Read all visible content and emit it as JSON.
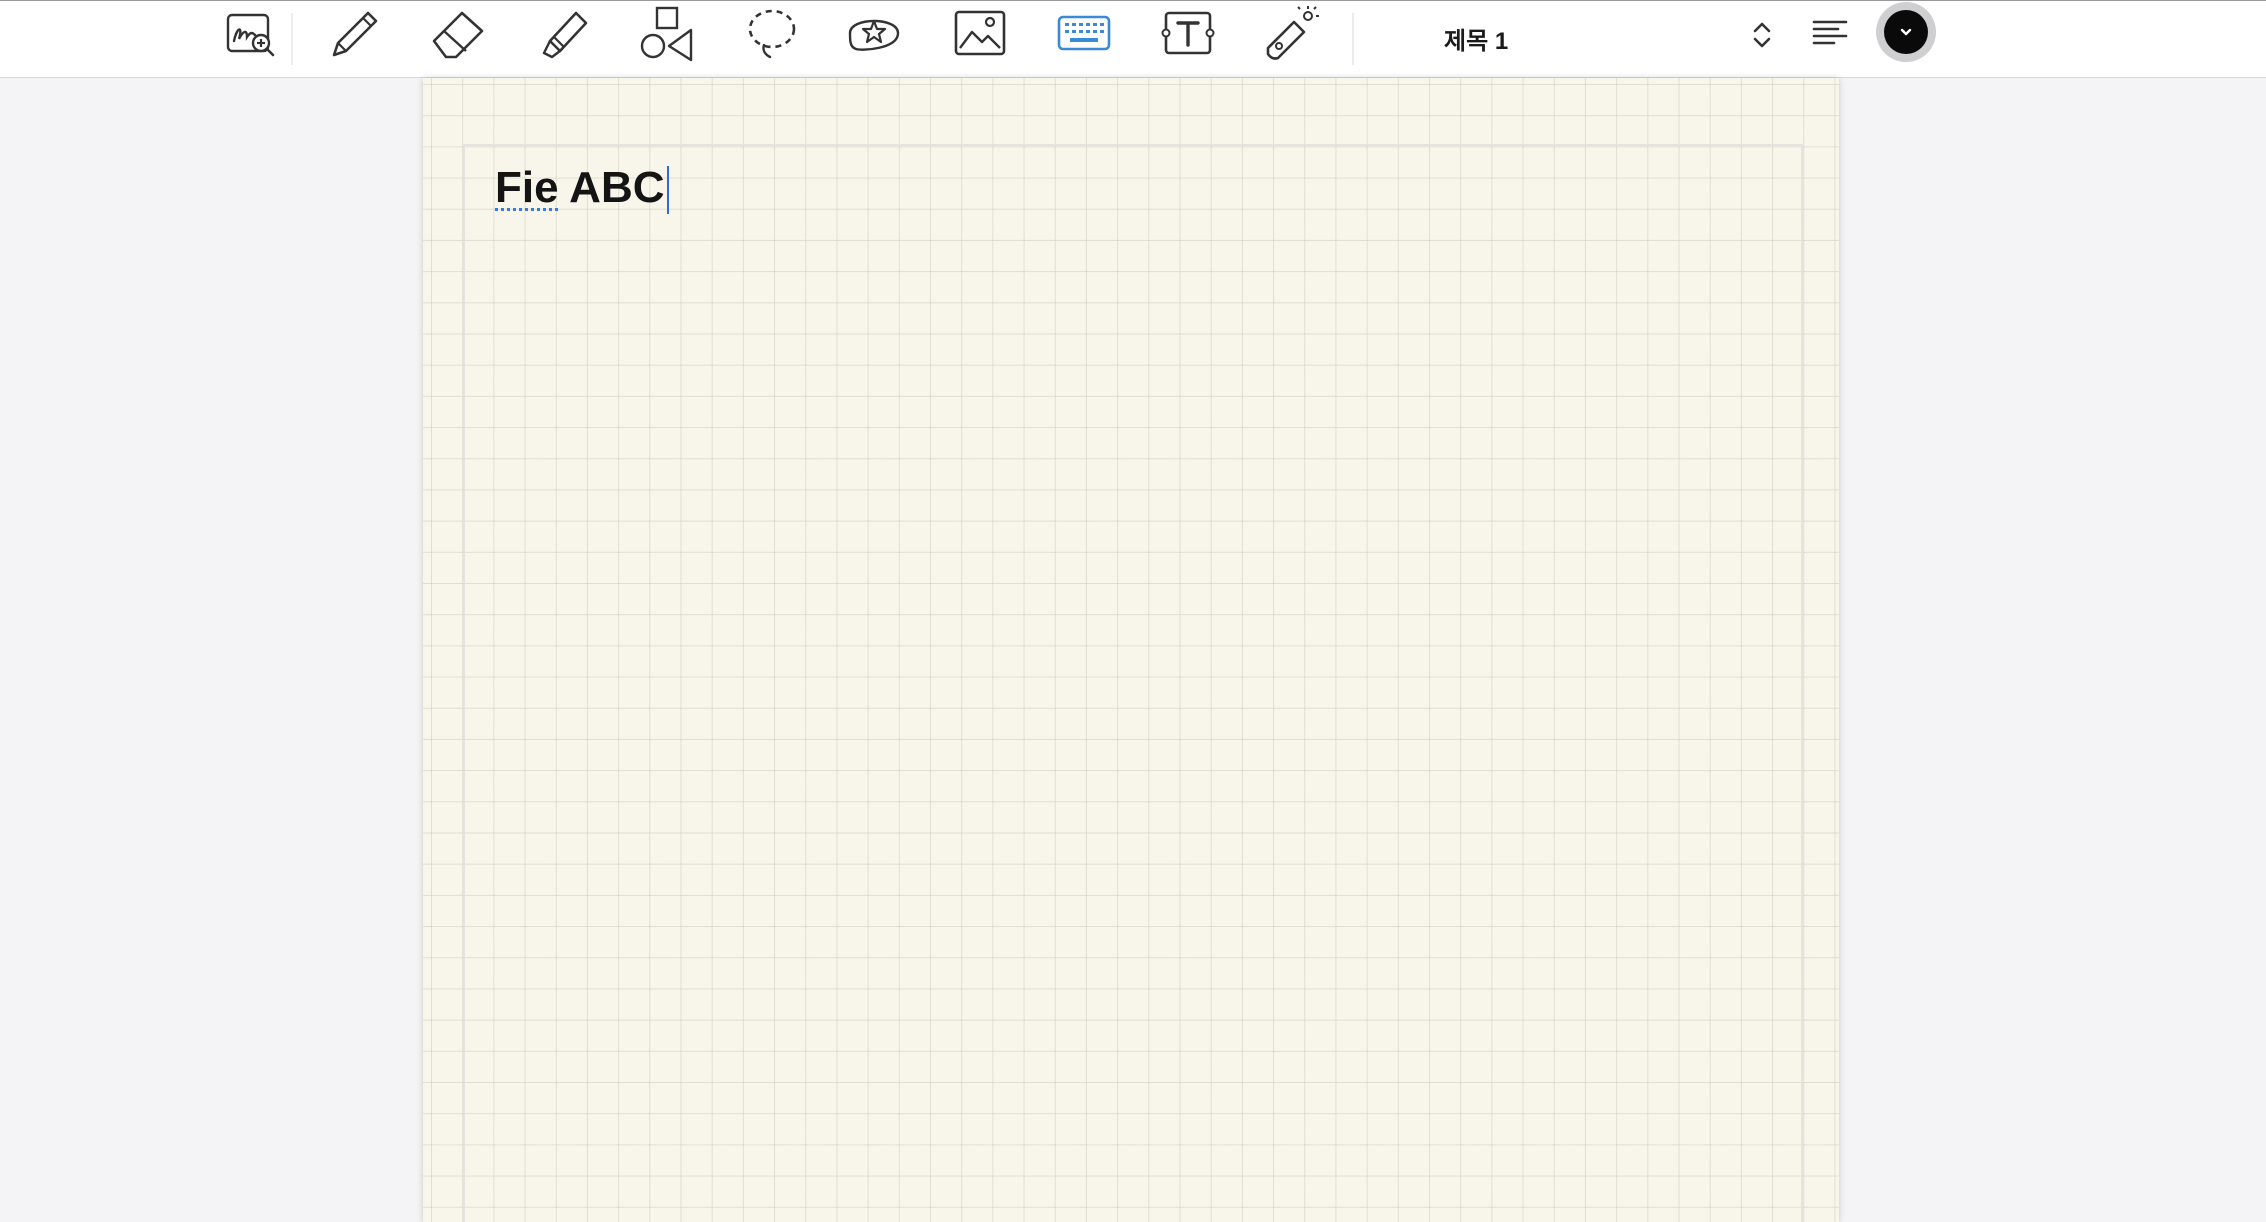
{
  "toolbar": {
    "tools": [
      {
        "name": "zoom-handwriting",
        "icon": "handwriting-zoom-icon"
      },
      {
        "name": "pen",
        "icon": "pen-icon"
      },
      {
        "name": "eraser",
        "icon": "eraser-icon"
      },
      {
        "name": "highlighter",
        "icon": "highlighter-icon"
      },
      {
        "name": "shapes",
        "icon": "shapes-icon"
      },
      {
        "name": "lasso",
        "icon": "lasso-icon"
      },
      {
        "name": "sticker",
        "icon": "sticker-star-icon"
      },
      {
        "name": "image",
        "icon": "image-icon"
      },
      {
        "name": "keyboard",
        "icon": "keyboard-icon",
        "active": true
      },
      {
        "name": "text-box",
        "icon": "text-box-icon"
      },
      {
        "name": "laser-pointer",
        "icon": "laser-pointer-icon"
      }
    ],
    "text_style": {
      "label": "제목 1",
      "icon": "chevron-up-down-icon"
    },
    "align_icon": "align-left-icon",
    "text_color": "#0a0a0a"
  },
  "colors": {
    "accent": "#3b8ad8",
    "page_background": "#f8f6eb",
    "spellcheck_underline": "#3b78e7"
  },
  "document": {
    "text_misspelled": "Fie",
    "text_rest": " ABC",
    "paper": "grid"
  }
}
